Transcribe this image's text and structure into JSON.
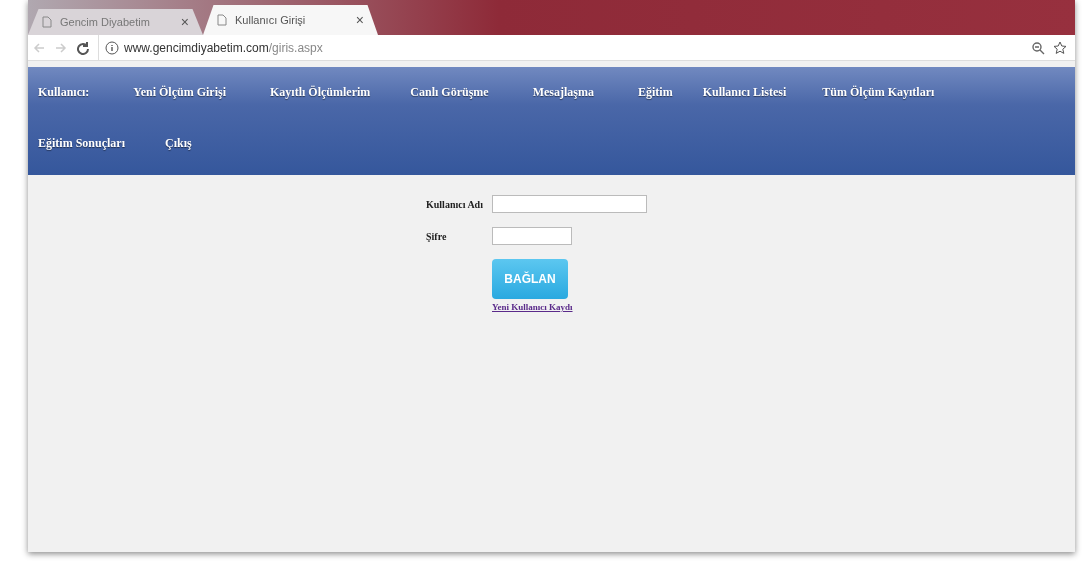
{
  "browser": {
    "tabs": [
      {
        "title": "Gencim Diyabetim",
        "selected": false
      },
      {
        "title": "Kullanıcı Girişi",
        "selected": true
      }
    ],
    "close_label": "×",
    "url_host": "www.gencimdiyabetim.com",
    "url_path": "/giris.aspx"
  },
  "nav": {
    "items": [
      "Kullanıcı:",
      "Yeni Ölçüm Girişi",
      "Kayıtlı Ölçümlerim",
      "Canlı Görüşme",
      "Mesajlaşma",
      "Eğitim",
      "Kullanıcı Listesi",
      "Tüm Ölçüm Kayıtları",
      "Eğitim Sonuçları",
      "Çıkış"
    ]
  },
  "login": {
    "username_label": "Kullanıcı Adı",
    "password_label": "Şifre",
    "submit": "BAĞLAN",
    "register_link": "Yeni Kullanıcı Kaydı"
  }
}
